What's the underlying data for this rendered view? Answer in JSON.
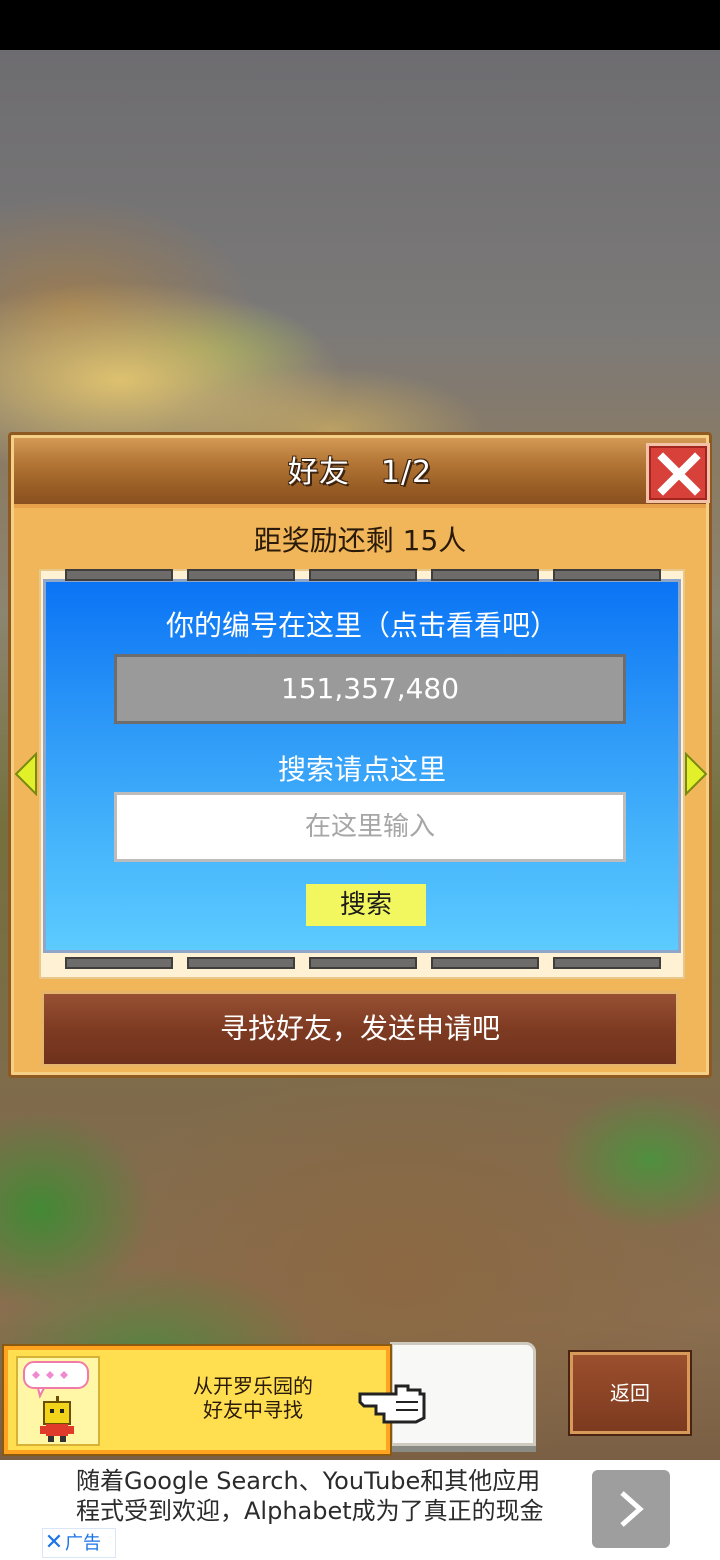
{
  "dialog": {
    "title": "好友　1/2",
    "reward_text": "距奖励还剩 15人",
    "id_caption": "你的编号在这里（点击看看吧）",
    "player_id": "151,357,480",
    "search_caption": "搜索请点这里",
    "search_placeholder": "在这里输入",
    "search_button": "搜索",
    "find_friends_button": "寻找好友，发送申请吧"
  },
  "hint": {
    "line1": "从开罗乐园的",
    "line2": "好友中寻找"
  },
  "return_button": "返回",
  "ad": {
    "line1": "随着Google Search、YouTube和其他应用",
    "line2": "程式受到欢迎，Alphabet成为了真正的现金",
    "badge": "广告"
  },
  "colors": {
    "dialog_bg": "#f1b65a",
    "card_blue": "#0a74f5",
    "search_button_bg": "#f2f760",
    "close_red": "#d8413a",
    "ad_badge_blue": "#1a73e8"
  }
}
